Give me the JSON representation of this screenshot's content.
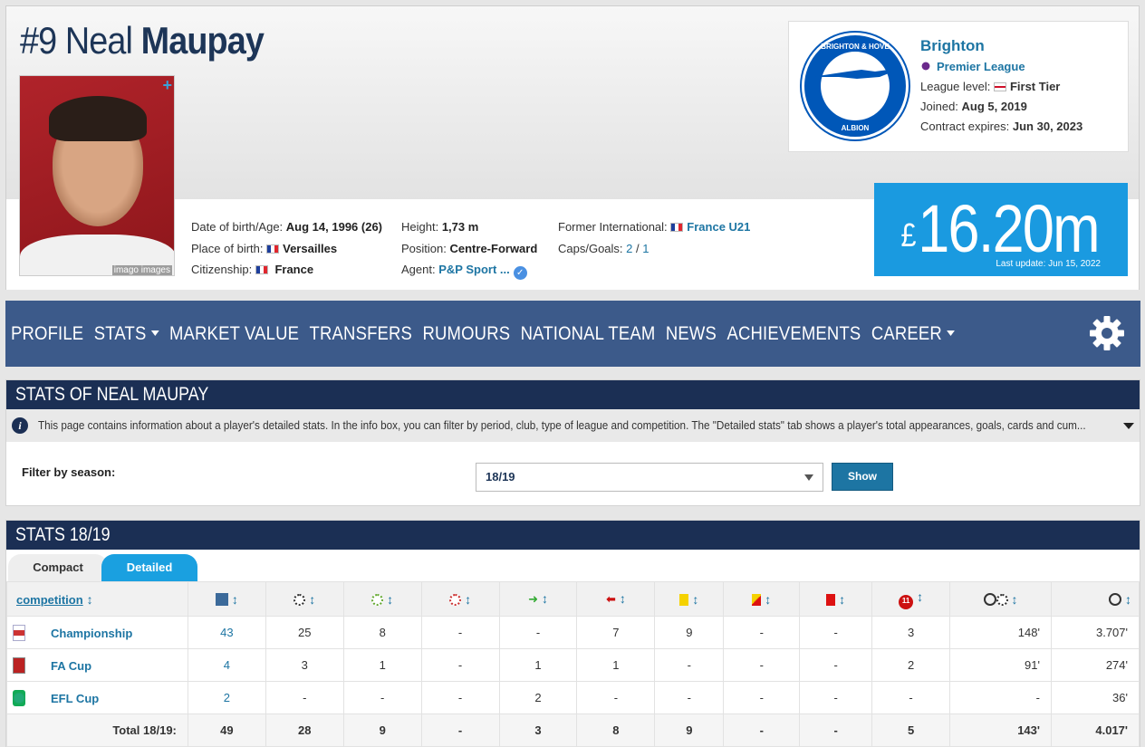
{
  "player": {
    "number": "#9",
    "first_name": "Neal",
    "last_name": "Maupay",
    "photo_credit": "imago images",
    "dob_label": "Date of birth/Age:",
    "dob_value": "Aug 14, 1996 (26)",
    "pob_label": "Place of birth:",
    "pob_value": "Versailles",
    "citizenship_label": "Citizenship:",
    "citizenship_value": "France",
    "height_label": "Height:",
    "height_value": "1,73 m",
    "position_label": "Position:",
    "position_value": "Centre-Forward",
    "agent_label": "Agent:",
    "agent_value": "P&P Sport ...",
    "former_label": "Former International:",
    "former_value": "France U21",
    "caps_label": "Caps/Goals:",
    "caps_value": "2",
    "caps_sep": "/",
    "goals_value": "1"
  },
  "club": {
    "name": "Brighton",
    "league": "Premier League",
    "level_label": "League level:",
    "level_value": "First Tier",
    "joined_label": "Joined:",
    "joined_value": "Aug 5, 2019",
    "contract_label": "Contract expires:",
    "contract_value": "Jun 30, 2023",
    "crest_top": "BRIGHTON & HOVE",
    "crest_bottom": "ALBION"
  },
  "market_value": {
    "currency": "£",
    "amount": "16.20m",
    "last_update": "Last update: Jun 15, 2022"
  },
  "nav": {
    "items": [
      "PROFILE",
      "STATS",
      "MARKET VALUE",
      "TRANSFERS",
      "RUMOURS",
      "NATIONAL TEAM",
      "NEWS",
      "ACHIEVEMENTS",
      "CAREER"
    ]
  },
  "stats_box": {
    "title": "STATS OF NEAL MAUPAY",
    "info_text": "This page contains information about a player's detailed stats. In the info box, you can filter by period, club, type of league and competition. The \"Detailed stats\" tab shows a player's total appearances, goals, cards and cum...",
    "filter_label": "Filter by season:",
    "season_selected": "18/19",
    "show_label": "Show"
  },
  "season_box": {
    "title": "STATS 18/19",
    "tab_compact": "Compact",
    "tab_detailed": "Detailed",
    "competition_header": "competition",
    "rows": [
      {
        "name": "Championship",
        "apps": "43",
        "c1": "25",
        "c2": "8",
        "c3": "-",
        "c4": "-",
        "c5": "7",
        "c6": "9",
        "c7": "-",
        "c8": "-",
        "c9": "3",
        "c10": "148'",
        "c11": "3.707'"
      },
      {
        "name": "FA Cup",
        "apps": "4",
        "c1": "3",
        "c2": "1",
        "c3": "-",
        "c4": "1",
        "c5": "1",
        "c6": "-",
        "c7": "-",
        "c8": "-",
        "c9": "2",
        "c10": "91'",
        "c11": "274'"
      },
      {
        "name": "EFL Cup",
        "apps": "2",
        "c1": "-",
        "c2": "-",
        "c3": "-",
        "c4": "2",
        "c5": "-",
        "c6": "-",
        "c7": "-",
        "c8": "-",
        "c9": "-",
        "c10": "-",
        "c11": "36'"
      }
    ],
    "total": {
      "label": "Total 18/19:",
      "apps": "49",
      "c1": "28",
      "c2": "9",
      "c3": "-",
      "c4": "3",
      "c5": "8",
      "c6": "9",
      "c7": "-",
      "c8": "-",
      "c9": "5",
      "c10": "143'",
      "c11": "4.017'"
    }
  }
}
